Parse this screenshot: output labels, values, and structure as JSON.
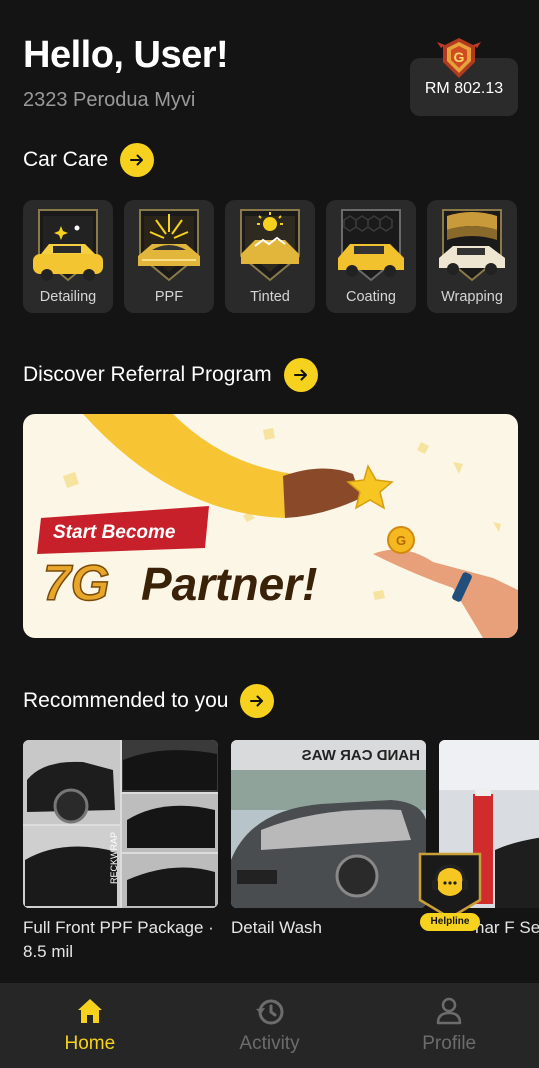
{
  "header": {
    "greeting": "Hello, User!",
    "car_model": "2323 Perodua Myvi",
    "wallet_amount": "RM 802.13",
    "wallet_badge_letter": "G"
  },
  "car_care": {
    "title": "Car Care",
    "items": [
      {
        "label": "Detailing"
      },
      {
        "label": "PPF"
      },
      {
        "label": "Tinted"
      },
      {
        "label": "Coating"
      },
      {
        "label": "Wrapping"
      }
    ]
  },
  "referral": {
    "title": "Discover Referral Program",
    "banner_tag": "Start Become",
    "banner_headline_brand": "7G",
    "banner_headline_rest": "Partner!"
  },
  "recommended": {
    "title": "Recommended to you",
    "items": [
      {
        "title": "Full Front PPF Package · 8.5 mil",
        "image_text": "RECKWRAP"
      },
      {
        "title": "Detail Wash",
        "image_text": "HAND CAR WAS"
      },
      {
        "title": "Windshield Sunbar Film Series",
        "title_visible": "nar F Series"
      }
    ]
  },
  "helpline": {
    "label": "Helpline"
  },
  "bottom_nav": {
    "items": [
      {
        "label": "Home",
        "icon": "home-icon",
        "active": true
      },
      {
        "label": "Activity",
        "icon": "history-icon",
        "active": false
      },
      {
        "label": "Profile",
        "icon": "profile-icon",
        "active": false
      }
    ]
  },
  "colors": {
    "background": "#141414",
    "card": "#2a2a2a",
    "accent": "#f6d21e",
    "muted": "#6c6c6c"
  }
}
